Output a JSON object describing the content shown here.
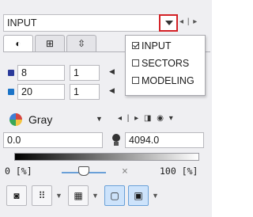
{
  "header": {
    "title": "INPUT",
    "dropdown_icon": "triangle-down",
    "nav_prev": "◂",
    "nav_sep": "|",
    "nav_next": "▸"
  },
  "tabs": [
    {
      "icon": "contrast-icon",
      "glyph": "◐",
      "active": true
    },
    {
      "icon": "grid-icon",
      "glyph": "⊞",
      "active": false
    },
    {
      "icon": "move-icon",
      "glyph": "⇳",
      "active": false
    }
  ],
  "rows": [
    {
      "color": "#2b3a9a",
      "value": "8",
      "value2": "1"
    },
    {
      "color": "#1b73c7",
      "value": "20",
      "value2": "1"
    }
  ],
  "lut": {
    "name": "Gray",
    "dd": "▼",
    "tools": "◂ | ▸ ◨ ◉ ▾"
  },
  "range": {
    "min": "0.0",
    "max": "4094.0"
  },
  "scale": {
    "min_label": "0 [%]",
    "max_label": "100 [%]",
    "x_mark": "×"
  },
  "bottom": {
    "b1": "◙",
    "b2": "⠿",
    "b3": "▦",
    "b4": "▢",
    "b5": "▣",
    "dd": "▼"
  },
  "menu": {
    "items": [
      {
        "label": "INPUT",
        "checked": true
      },
      {
        "label": "SECTORS",
        "checked": false
      },
      {
        "label": "MODELING",
        "checked": false
      }
    ]
  },
  "accent": "#d32126"
}
